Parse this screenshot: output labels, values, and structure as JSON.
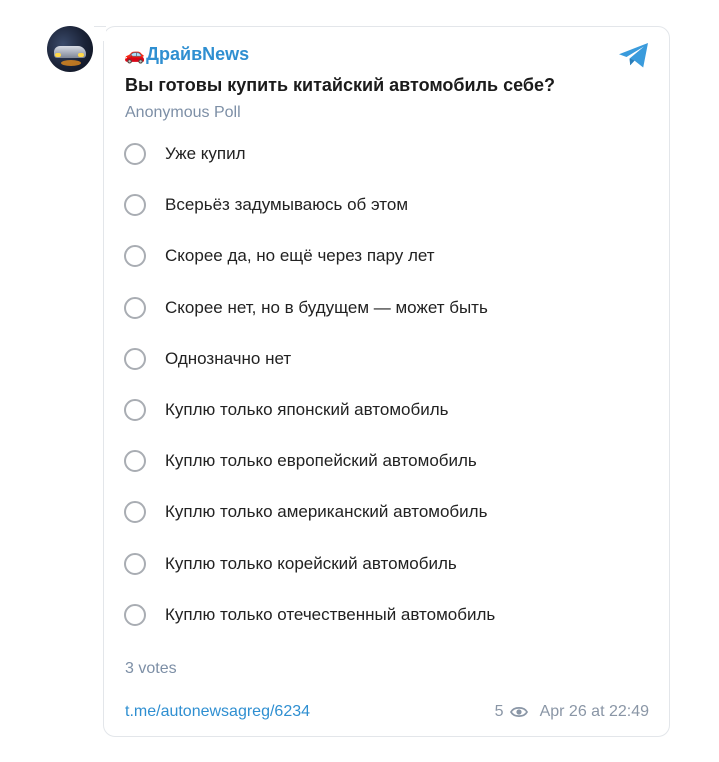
{
  "post": {
    "channel_emoji": "🚗",
    "channel_name": "ДрайвNews",
    "question": "Вы готовы купить китайский автомобиль себе?",
    "poll_type": "Anonymous Poll",
    "options": [
      "Уже купил",
      "Всерьёз задумываюсь об этом",
      "Скорее да, но ещё через пару лет",
      "Скорее нет, но в будущем — может быть",
      "Однозначно нет",
      "Куплю только японский автомобиль",
      "Куплю только европейский автомобиль",
      "Куплю только американский автомобиль",
      "Куплю только корейский автомобиль",
      "Куплю только отечественный автомобиль"
    ],
    "votes": "3 votes",
    "link": "t.me/autonewsagreg/6234",
    "views": "5",
    "date": "Apr 26 at 22:49"
  },
  "icons": {
    "telegram": "telegram-icon",
    "views": "eye-icon",
    "avatar": "channel-avatar"
  },
  "colors": {
    "accent": "#2f8fd1",
    "muted": "#7d8fa6",
    "radio_border": "#a9adb3"
  }
}
